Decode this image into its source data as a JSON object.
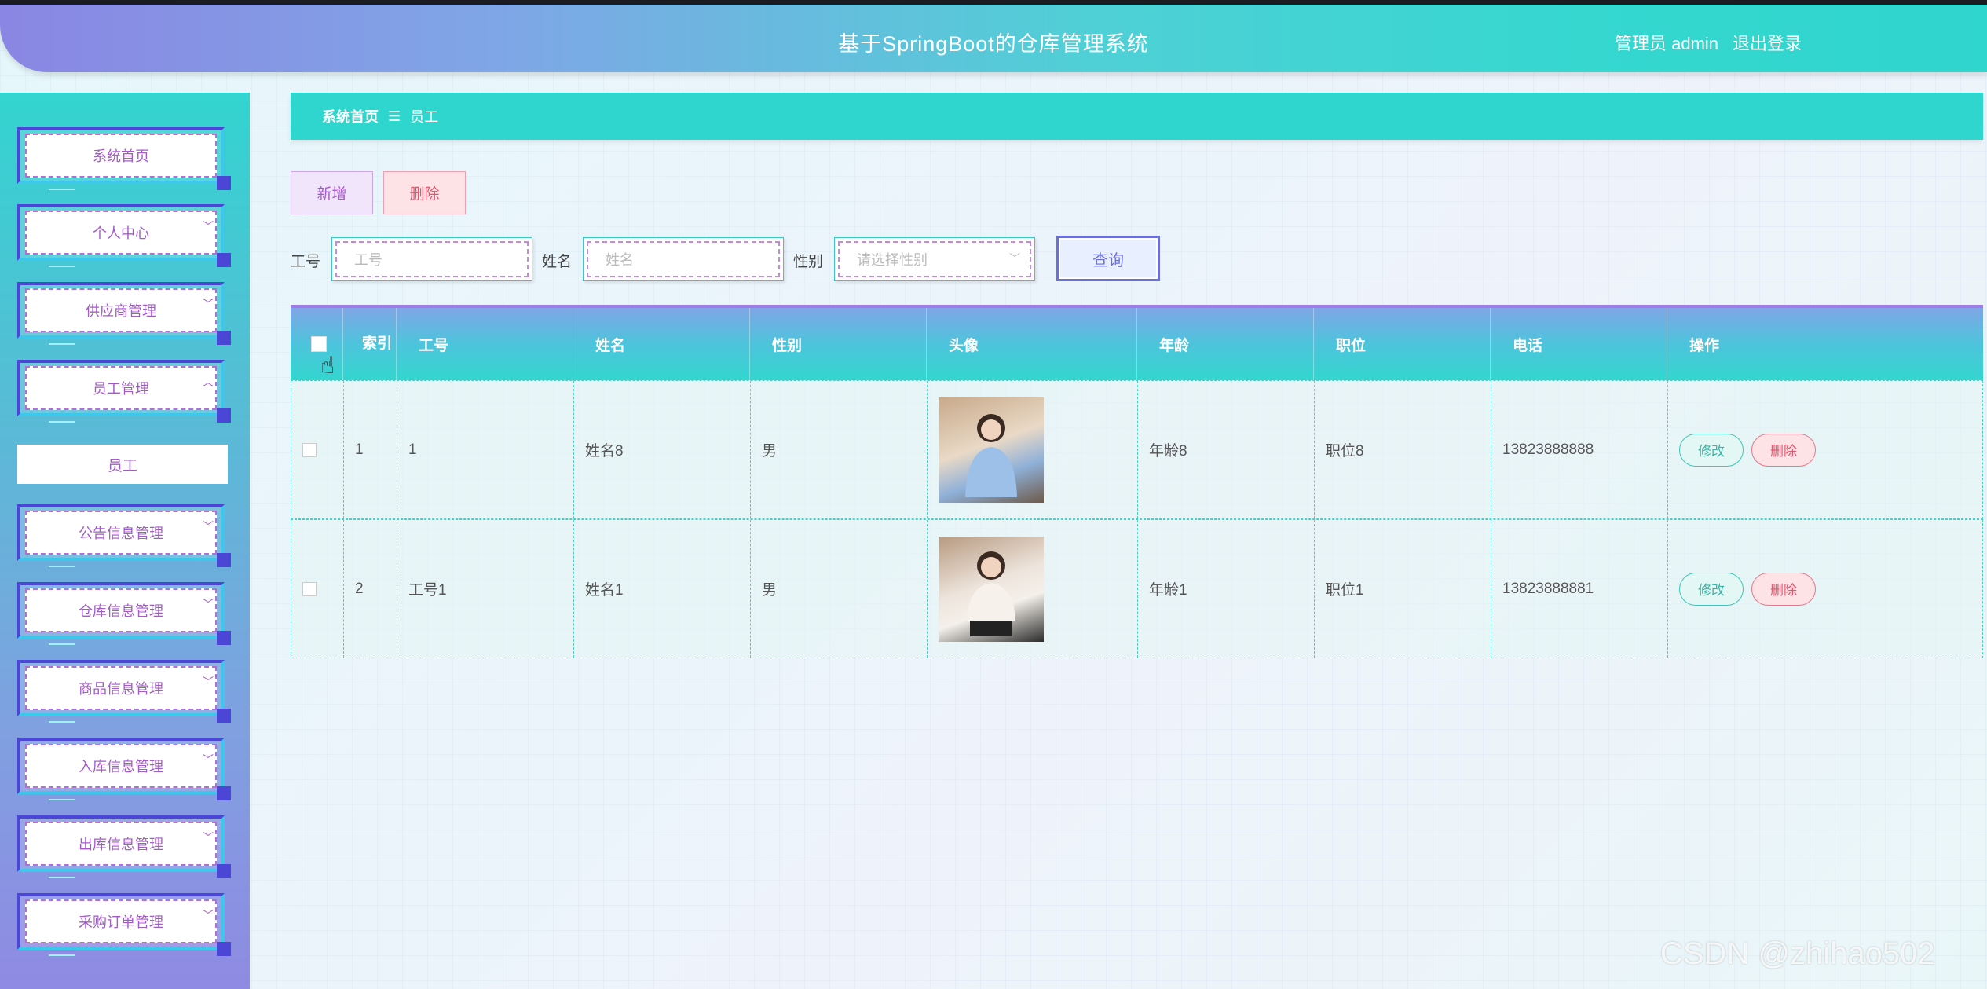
{
  "header": {
    "title": "基于SpringBoot的仓库管理系统",
    "user_label": "管理员 admin",
    "logout_label": "退出登录"
  },
  "sidebar": {
    "items": [
      {
        "label": "系统首页",
        "has_chevron": false,
        "chevron": ""
      },
      {
        "label": "个人中心",
        "has_chevron": true,
        "chevron": "﹀"
      },
      {
        "label": "供应商管理",
        "has_chevron": true,
        "chevron": "﹀"
      },
      {
        "label": "员工管理",
        "has_chevron": true,
        "chevron": "︿"
      },
      {
        "label": "公告信息管理",
        "has_chevron": true,
        "chevron": "﹀"
      },
      {
        "label": "仓库信息管理",
        "has_chevron": true,
        "chevron": "﹀"
      },
      {
        "label": "商品信息管理",
        "has_chevron": true,
        "chevron": "﹀"
      },
      {
        "label": "入库信息管理",
        "has_chevron": true,
        "chevron": "﹀"
      },
      {
        "label": "出库信息管理",
        "has_chevron": true,
        "chevron": "﹀"
      },
      {
        "label": "采购订单管理",
        "has_chevron": true,
        "chevron": "﹀"
      }
    ],
    "submenu_active": "员工"
  },
  "breadcrumb": {
    "home": "系统首页",
    "separator": "☰",
    "current": "员工"
  },
  "toolbar": {
    "add_label": "新增",
    "delete_label": "删除"
  },
  "search": {
    "emp_no_label": "工号",
    "emp_no_placeholder": "工号",
    "name_label": "姓名",
    "name_placeholder": "姓名",
    "gender_label": "性别",
    "gender_placeholder": "请选择性别",
    "query_label": "查询"
  },
  "table": {
    "headers": {
      "index": "索引",
      "emp_no": "工号",
      "name": "姓名",
      "gender": "性别",
      "avatar": "头像",
      "age": "年龄",
      "position": "职位",
      "phone": "电话",
      "actions": "操作"
    },
    "rows": [
      {
        "index": "1",
        "emp_no": "1",
        "name": "姓名8",
        "gender": "男",
        "age": "年龄8",
        "position": "职位8",
        "phone": "13823888888"
      },
      {
        "index": "2",
        "emp_no": "工号1",
        "name": "姓名1",
        "gender": "男",
        "age": "年龄1",
        "position": "职位1",
        "phone": "13823888881"
      }
    ],
    "edit_label": "修改",
    "delete_label": "删除"
  },
  "watermark": "CSDN @zhihao502",
  "colors": {
    "accent_teal": "#2fd6cd",
    "accent_purple": "#a35bc9",
    "danger": "#e0566d"
  }
}
